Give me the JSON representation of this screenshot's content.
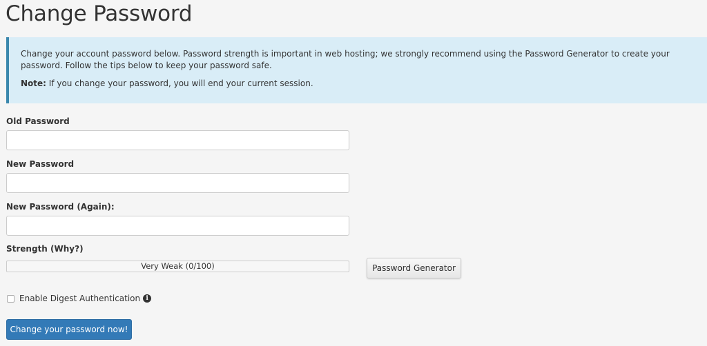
{
  "page": {
    "title": "Change Password"
  },
  "info": {
    "intro": "Change your account password below. Password strength is important in web hosting; we strongly recommend using the Password Generator to create your password. Follow the tips below to keep your password safe.",
    "note_label": "Note:",
    "note_text": " If you change your password, you will end your current session."
  },
  "form": {
    "old_password": {
      "label": "Old Password",
      "value": "",
      "placeholder": ""
    },
    "new_password": {
      "label": "New Password",
      "value": "",
      "placeholder": ""
    },
    "new_password_again": {
      "label": "New Password (Again):",
      "value": "",
      "placeholder": ""
    },
    "strength": {
      "label": "Strength (Why?)",
      "text": "Very Weak (0/100)",
      "value": 0
    },
    "generator_button": "Password Generator",
    "digest": {
      "label": "Enable Digest Authentication",
      "checked": false,
      "icon": "info-circle-icon"
    },
    "submit_button": "Change your password now!"
  },
  "colors": {
    "background": "#f5f5f5",
    "info_bg": "#d9edf7",
    "info_border": "#3a87ad",
    "primary": "#337ab7"
  }
}
